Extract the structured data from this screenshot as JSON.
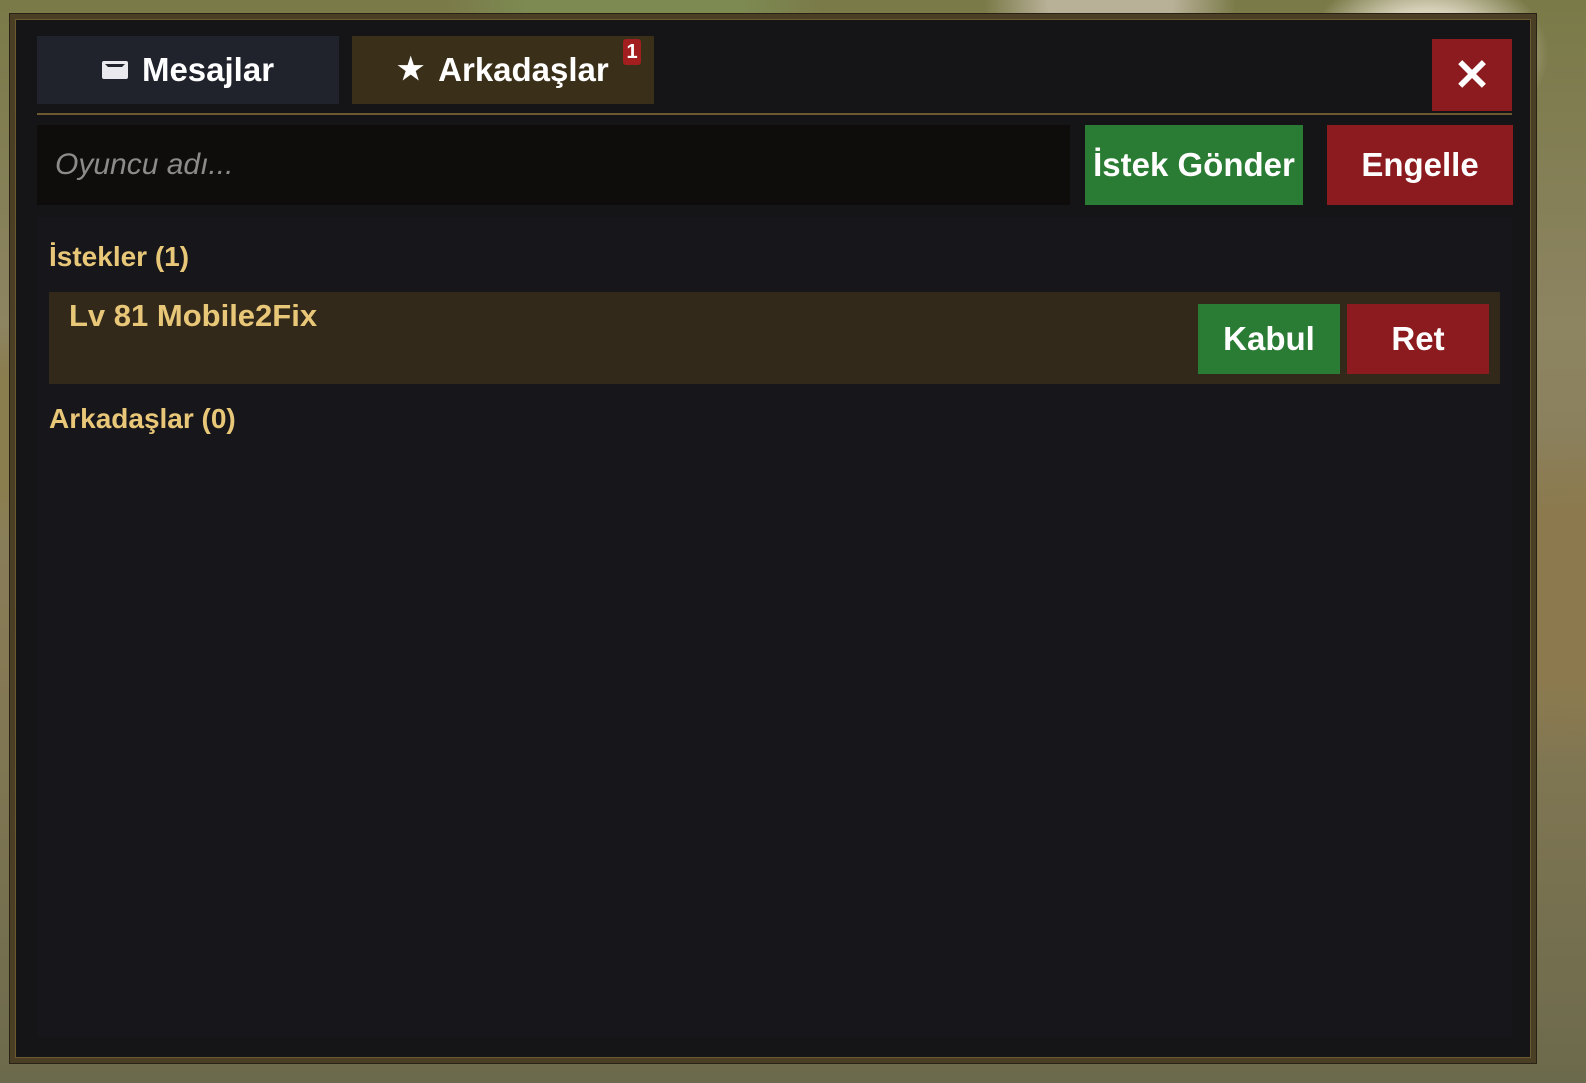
{
  "tabs": [
    {
      "label": "Mesajlar",
      "icon": "mail-icon",
      "active": false
    },
    {
      "label": "Arkadaşlar",
      "icon": "star-icon",
      "active": true,
      "badge": "1"
    }
  ],
  "close": {
    "label": "✕"
  },
  "search": {
    "placeholder": "Oyuncu adı...",
    "value": ""
  },
  "actions": {
    "send_request": "İstek Gönder",
    "block": "Engelle"
  },
  "requests": {
    "title": "İstekler (1)",
    "items": [
      {
        "name": "Lv 81 Mobile2Fix",
        "accept": "Kabul",
        "reject": "Ret"
      }
    ]
  },
  "friends": {
    "title": "Arkadaşlar (0)",
    "items": []
  },
  "colors": {
    "accent_gold": "#e8c878",
    "success": "#2a7b33",
    "danger": "#8b1b1e",
    "panel_bg": "#151416"
  }
}
